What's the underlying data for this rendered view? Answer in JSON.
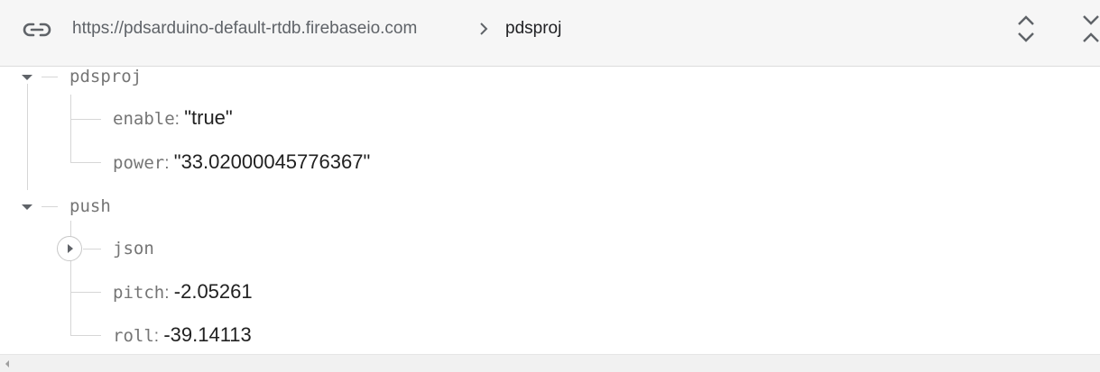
{
  "header": {
    "url": "https://pdsarduino-default-rtdb.firebaseio.com",
    "crumb": "pdsproj",
    "icons": {
      "link": "link-icon",
      "separator": "chevron-right-icon",
      "expand_all": "unfold-more-icon",
      "collapse_all": "unfold-less-icon"
    }
  },
  "tree": {
    "pdsproj": {
      "key": "pdsproj",
      "children": {
        "enable": {
          "key": "enable",
          "value": "\"true\""
        },
        "power": {
          "key": "power",
          "value": "\"33.02000045776367\""
        }
      }
    },
    "push": {
      "key": "push",
      "children": {
        "json": {
          "key": "json"
        },
        "pitch": {
          "key": "pitch",
          "value": "-2.05261"
        },
        "roll": {
          "key": "roll",
          "value": "-39.14113"
        }
      }
    }
  },
  "colors": {
    "header_bg": "#f6f6f6",
    "key_text": "#757575",
    "value_text": "#212121",
    "tree_line": "#d6d6d6"
  }
}
